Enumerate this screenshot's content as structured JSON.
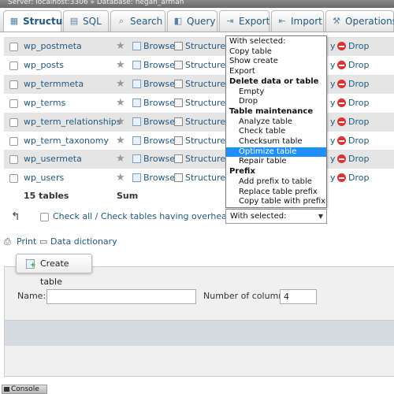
{
  "breadcrumb": {
    "server": "Server: localhost:3306",
    "separator": "»",
    "database": "Database: negan_arman"
  },
  "tabs": [
    {
      "label": "Structure",
      "icon": "table-structure-icon"
    },
    {
      "label": "SQL",
      "icon": "sql-icon"
    },
    {
      "label": "Search",
      "icon": "search-icon"
    },
    {
      "label": "Query",
      "icon": "query-icon"
    },
    {
      "label": "Export",
      "icon": "export-icon"
    },
    {
      "label": "Import",
      "icon": "import-icon"
    },
    {
      "label": "Operations",
      "icon": "wrench-icon"
    }
  ],
  "table_rows": [
    {
      "name": "wp_postmeta"
    },
    {
      "name": "wp_posts"
    },
    {
      "name": "wp_termmeta"
    },
    {
      "name": "wp_terms"
    },
    {
      "name": "wp_term_relationships"
    },
    {
      "name": "wp_term_taxonomy"
    },
    {
      "name": "wp_usermeta"
    },
    {
      "name": "wp_users"
    }
  ],
  "row_actions": {
    "browse": "Browse",
    "structure": "Structure",
    "partial": "y",
    "drop": "Drop"
  },
  "summary": {
    "count": "15 tables",
    "sum": "Sum"
  },
  "check_all_label": "Check all / Check tables having overhead",
  "with_selected_select": {
    "value": "With selected:"
  },
  "with_selected_options": [
    {
      "label": "With selected:",
      "kind": "item"
    },
    {
      "label": "Copy table",
      "kind": "item"
    },
    {
      "label": "Show create",
      "kind": "item"
    },
    {
      "label": "Export",
      "kind": "item"
    },
    {
      "label": "Delete data or table",
      "kind": "header"
    },
    {
      "label": "Empty",
      "kind": "sub"
    },
    {
      "label": "Drop",
      "kind": "sub"
    },
    {
      "label": "Table maintenance",
      "kind": "header"
    },
    {
      "label": "Analyze table",
      "kind": "sub"
    },
    {
      "label": "Check table",
      "kind": "sub"
    },
    {
      "label": "Checksum table",
      "kind": "sub"
    },
    {
      "label": "Optimize table",
      "kind": "sub-selected"
    },
    {
      "label": "Repair table",
      "kind": "sub"
    },
    {
      "label": "Prefix",
      "kind": "header"
    },
    {
      "label": "Add prefix to table",
      "kind": "sub"
    },
    {
      "label": "Replace table prefix",
      "kind": "sub"
    },
    {
      "label": "Copy table with prefix",
      "kind": "sub"
    }
  ],
  "links": {
    "print": "Print",
    "data_dictionary": "Data dictionary"
  },
  "create_table": {
    "button_label": "Create table",
    "name_label": "Name:",
    "name_value": "",
    "columns_label": "Number of columns:",
    "columns_value": "4"
  },
  "console_label": "Console",
  "colors": {
    "link": "#235a81",
    "selected_option": "#1e90ff",
    "drop_icon": "#dd3333",
    "row_odd": "#e5e5e5"
  }
}
